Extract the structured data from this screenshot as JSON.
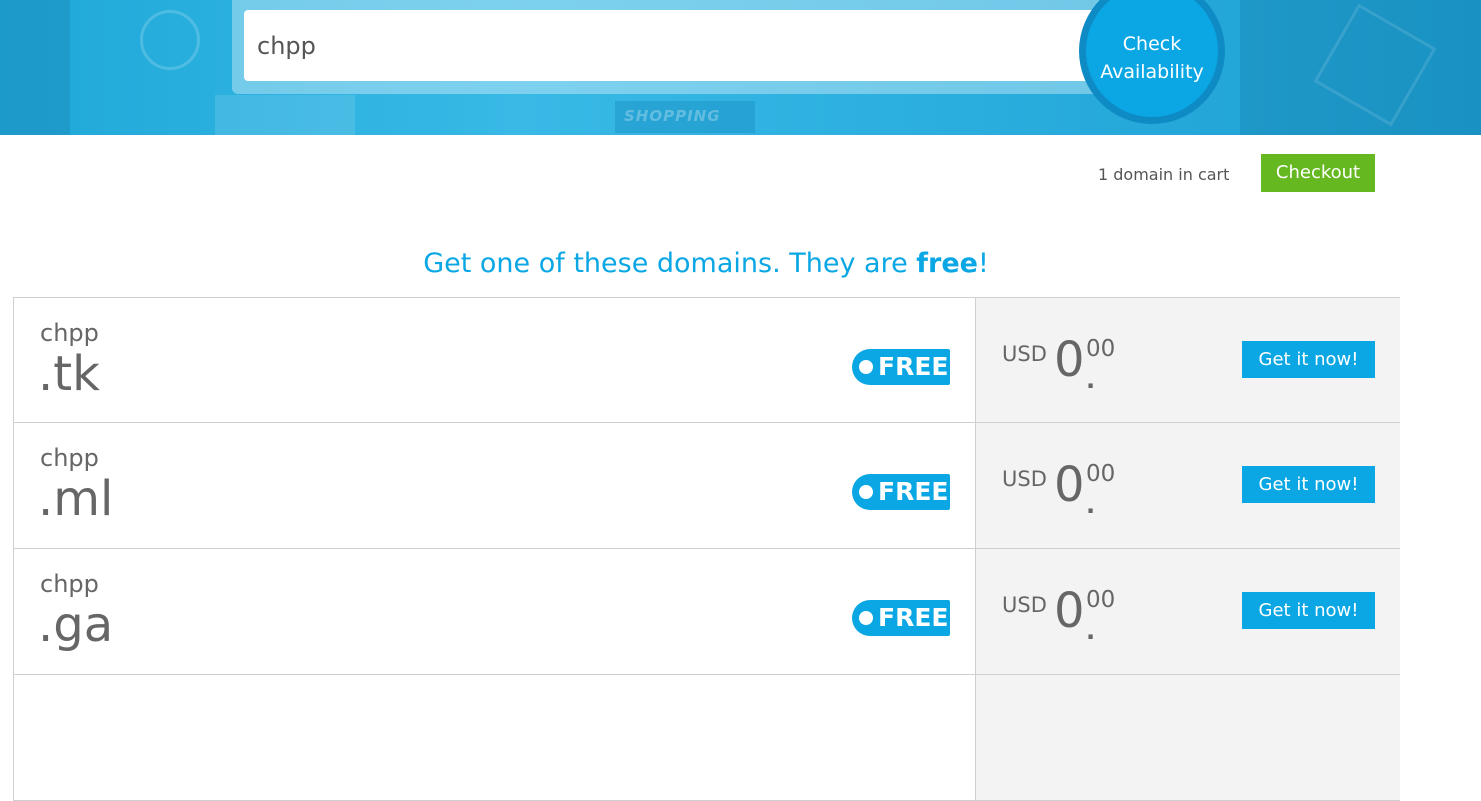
{
  "hero": {
    "banner_word": "SHOPPING"
  },
  "search": {
    "value": "chpp",
    "check_line1": "Check",
    "check_line2": "Availability"
  },
  "cart": {
    "count_text": "1 domain in cart",
    "checkout_label": "Checkout"
  },
  "headline": {
    "before": "Get one of these domains. They are ",
    "bold": "free",
    "after": "!"
  },
  "results": [
    {
      "name": "chpp",
      "tld": ".tk",
      "badge": "FREE",
      "currency": "USD",
      "price_int": "0",
      "price_sep": ".",
      "price_dec": "00",
      "button": "Get it now!"
    },
    {
      "name": "chpp",
      "tld": ".ml",
      "badge": "FREE",
      "currency": "USD",
      "price_int": "0",
      "price_sep": ".",
      "price_dec": "00",
      "button": "Get it now!"
    },
    {
      "name": "chpp",
      "tld": ".ga",
      "badge": "FREE",
      "currency": "USD",
      "price_int": "0",
      "price_sep": ".",
      "price_dec": "00",
      "button": "Get it now!"
    }
  ],
  "colors": {
    "accent": "#0aa7e4",
    "checkout": "#66b821",
    "text": "#666666",
    "price_bg": "#f3f3f3"
  }
}
